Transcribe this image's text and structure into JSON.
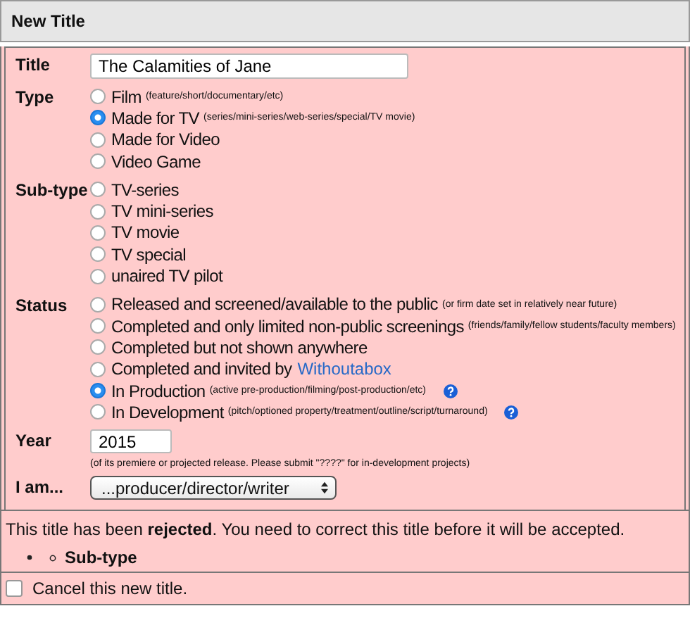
{
  "header": {
    "title": "New Title"
  },
  "title_field": {
    "label": "Title",
    "value": "The Calamities of Jane"
  },
  "type": {
    "label": "Type",
    "options": [
      {
        "label": "Film",
        "note": "(feature/short/documentary/etc)",
        "selected": false
      },
      {
        "label": "Made for TV",
        "note": "(series/mini-series/web-series/special/TV movie)",
        "selected": true
      },
      {
        "label": "Made for Video",
        "selected": false
      },
      {
        "label": "Video Game",
        "selected": false
      }
    ]
  },
  "subtype": {
    "label": "Sub-type",
    "options": [
      {
        "label": "TV-series",
        "selected": false
      },
      {
        "label": "TV mini-series",
        "selected": false
      },
      {
        "label": "TV movie",
        "selected": false
      },
      {
        "label": "TV special",
        "selected": false
      },
      {
        "label": "unaired TV pilot",
        "selected": false
      }
    ]
  },
  "status": {
    "label": "Status",
    "options": [
      {
        "label": "Released and screened/available to the public",
        "note": "(or firm date set in relatively near future)",
        "selected": false
      },
      {
        "label": "Completed and only limited non-public screenings",
        "note": "(friends/family/fellow students/faculty members)",
        "selected": false
      },
      {
        "label": "Completed but not shown anywhere",
        "selected": false
      },
      {
        "label": "Completed and invited by",
        "link": "Withoutabox",
        "selected": false
      },
      {
        "label": "In Production",
        "note": "(active pre-production/filming/post-production/etc)",
        "help": true,
        "selected": true
      },
      {
        "label": "In Development",
        "note": "(pitch/optioned property/treatment/outline/script/turnaround)",
        "help": true,
        "selected": false
      }
    ]
  },
  "year": {
    "label": "Year",
    "value": "2015",
    "note": "(of its premiere or projected release. Please submit \"????\" for in-development projects)"
  },
  "role": {
    "label": "I am...",
    "value": "...producer/director/writer"
  },
  "rejection": {
    "message": "This title has been **rejected**. You need to correct this title before it will be accepted.",
    "issues": [
      "Sub-type"
    ]
  },
  "cancel": {
    "label": "Cancel this new title.",
    "checked": false
  }
}
